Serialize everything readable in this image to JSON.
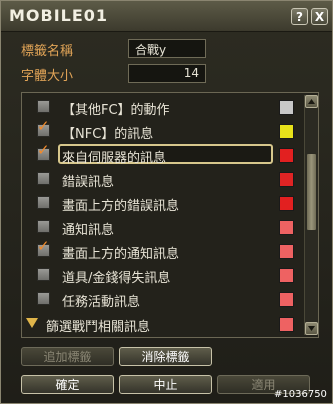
{
  "window": {
    "title": "MOBILE01"
  },
  "titlebar_buttons": {
    "help": "?",
    "close": "X"
  },
  "form": {
    "name_label": "標籤名稱",
    "name_value": "合戰y",
    "fontsize_label": "字體大小",
    "fontsize_value": "14"
  },
  "list": {
    "rows": [
      {
        "label": "【其他FC】的動作",
        "checked": false,
        "color": "#c8c8c8"
      },
      {
        "label": "【NFC】的訊息",
        "checked": true,
        "color": "#e8e21a"
      },
      {
        "label": "來自伺服器的訊息",
        "checked": true,
        "color": "#e22020",
        "selected": true
      },
      {
        "label": "錯誤訊息",
        "checked": false,
        "color": "#e02424"
      },
      {
        "label": "畫面上方的錯誤訊息",
        "checked": false,
        "color": "#e22020"
      },
      {
        "label": "通知訊息",
        "checked": false,
        "color": "#ee6262"
      },
      {
        "label": "畫面上方的通知訊息",
        "checked": true,
        "color": "#ee6262"
      },
      {
        "label": "道具/金錢得失訊息",
        "checked": false,
        "color": "#ee6262"
      },
      {
        "label": "任務活動訊息",
        "checked": false,
        "color": "#ee6262"
      }
    ],
    "category": "篩選戰鬥相關訊息",
    "category_color": "#ee6262"
  },
  "buttons": {
    "add_tag": "追加標籤",
    "remove_tag": "消除標籤",
    "ok": "確定",
    "cancel": "中止",
    "apply": "適用"
  },
  "watermark": "#1036750",
  "icons": {
    "check": "check-mark",
    "scroll_up": "triangle-up",
    "scroll_down": "triangle-down",
    "category": "triangle-down"
  }
}
